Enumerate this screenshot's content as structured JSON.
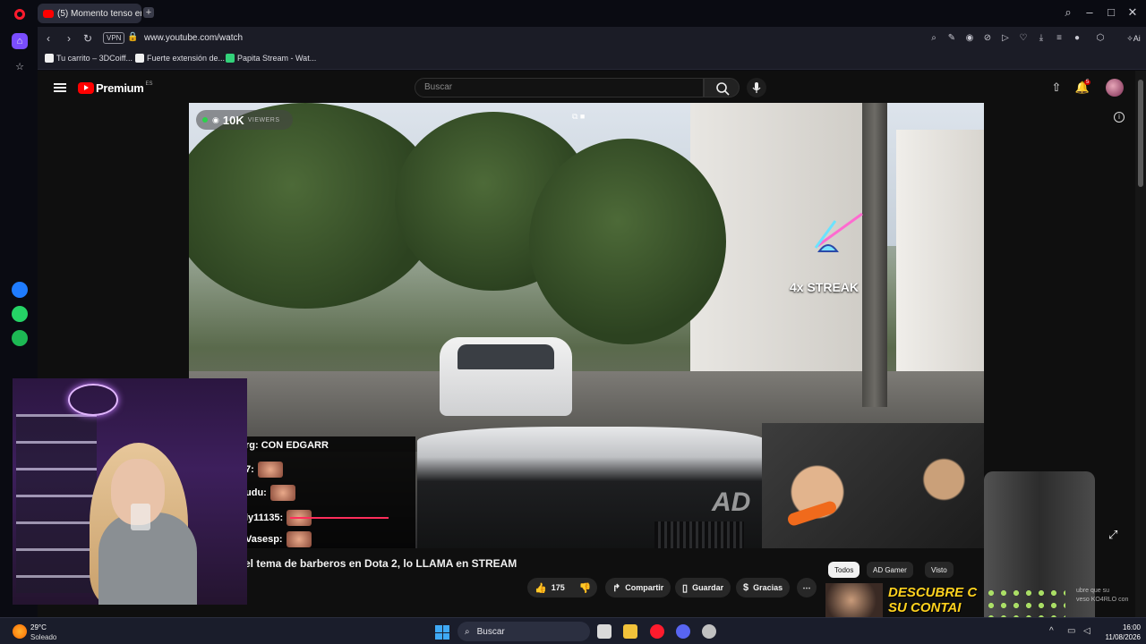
{
  "browser": {
    "tab_title": "(5) Momento tenso entre",
    "url": "www.youtube.com/watch",
    "vpn_label": "VPN",
    "ai_label": "Ai",
    "bookmarks": [
      {
        "label": "Tu carrito – 3DCoiff...",
        "color": "#f0f0f0"
      },
      {
        "label": "Fuerte extensión de...",
        "color": "#f0f0f0"
      },
      {
        "label": "Papita Stream - Wat...",
        "color": "#33d17a"
      }
    ]
  },
  "youtube": {
    "brand": "Premium",
    "brand_region": "ES",
    "search_placeholder": "Buscar",
    "notification_count": "5",
    "video": {
      "viewers": "10K",
      "viewers_label": "VIEWERS",
      "streak_text": "4x STREAK",
      "watermark": "AD",
      "chat": [
        {
          "user": "rg:",
          "text": "CON EDGARR"
        },
        {
          "user": "7:",
          "text": ""
        },
        {
          "user": "udu:",
          "text": ""
        },
        {
          "user": "ly11135:",
          "text": ""
        },
        {
          "user": "Vasesp:",
          "text": ""
        }
      ]
    },
    "title": "el tema de barberos en Dota 2, lo LLAMA en STREAM",
    "actions": {
      "likes": "175",
      "share": "Compartir",
      "save": "Guardar",
      "thanks": "Gracias"
    },
    "chips": [
      "Todos",
      "AD Gamer",
      "Visto"
    ],
    "reco_headline": "DESCUBRE C",
    "reco_subline": "SU CONTAI",
    "reco_snippet_1": "ubre que su",
    "reco_snippet_2": "veso KO4RLO con",
    "ad_badge": "AD"
  },
  "taskbar": {
    "temperature": "29°C",
    "condition": "Soleado",
    "search_label": "Buscar",
    "time": "16:00",
    "date": "11/08/2026"
  }
}
